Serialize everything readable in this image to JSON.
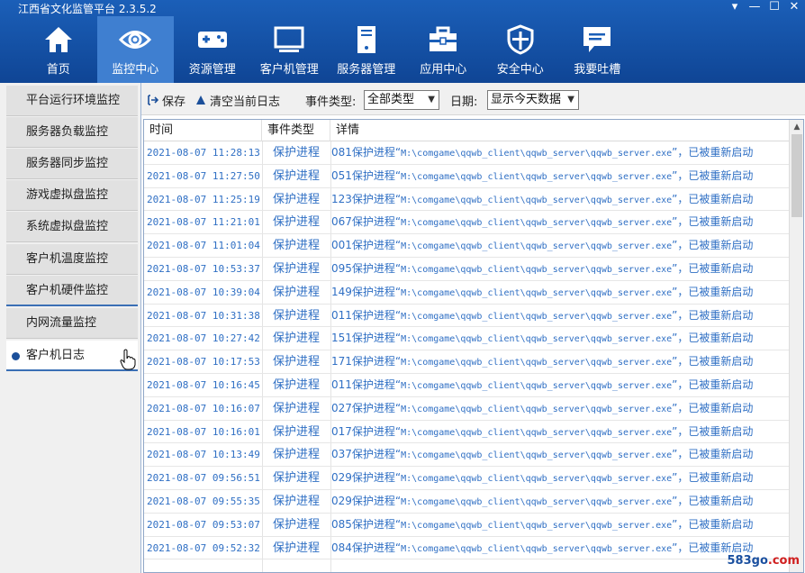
{
  "app": {
    "title": "江西省文化监管平台 2.3.5.2"
  },
  "window_controls": {
    "dropdown": "▾",
    "minimize": "—",
    "maximize": "☐",
    "close": "✕"
  },
  "nav": [
    {
      "label": "首页",
      "icon": "home-icon"
    },
    {
      "label": "监控中心",
      "icon": "eye-icon",
      "active": true
    },
    {
      "label": "资源管理",
      "icon": "gamepad-icon"
    },
    {
      "label": "客户机管理",
      "icon": "monitor-icon"
    },
    {
      "label": "服务器管理",
      "icon": "server-icon"
    },
    {
      "label": "应用中心",
      "icon": "toolbox-icon"
    },
    {
      "label": "安全中心",
      "icon": "shield-icon"
    },
    {
      "label": "我要吐槽",
      "icon": "chat-bubble-icon"
    }
  ],
  "sidebar": [
    {
      "label": "平台运行环境监控"
    },
    {
      "label": "服务器负载监控"
    },
    {
      "label": "服务器同步监控"
    },
    {
      "label": "游戏虚拟盘监控"
    },
    {
      "label": "系统虚拟盘监控"
    },
    {
      "label": "客户机温度监控"
    },
    {
      "label": "客户机硬件监控"
    },
    {
      "label": "内网流量监控"
    },
    {
      "label": "客户机日志",
      "active": true
    }
  ],
  "toolbar": {
    "save_label": "保存",
    "clear_label": "清空当前日志",
    "event_type_label": "事件类型:",
    "event_type_value": "全部类型",
    "date_label": "日期:",
    "date_value": "显示今天数据"
  },
  "table": {
    "columns": [
      "时间",
      "事件类型",
      "详情"
    ],
    "rows": [
      {
        "time": "2021-08-07 11:28:13",
        "type": "保护进程",
        "id": "081"
      },
      {
        "time": "2021-08-07 11:27:50",
        "type": "保护进程",
        "id": "051"
      },
      {
        "time": "2021-08-07 11:25:19",
        "type": "保护进程",
        "id": "123"
      },
      {
        "time": "2021-08-07 11:21:01",
        "type": "保护进程",
        "id": "067"
      },
      {
        "time": "2021-08-07 11:01:04",
        "type": "保护进程",
        "id": "001"
      },
      {
        "time": "2021-08-07 10:53:37",
        "type": "保护进程",
        "id": "095"
      },
      {
        "time": "2021-08-07 10:39:04",
        "type": "保护进程",
        "id": "149"
      },
      {
        "time": "2021-08-07 10:31:38",
        "type": "保护进程",
        "id": "011"
      },
      {
        "time": "2021-08-07 10:27:42",
        "type": "保护进程",
        "id": "151"
      },
      {
        "time": "2021-08-07 10:17:53",
        "type": "保护进程",
        "id": "171"
      },
      {
        "time": "2021-08-07 10:16:45",
        "type": "保护进程",
        "id": "011"
      },
      {
        "time": "2021-08-07 10:16:07",
        "type": "保护进程",
        "id": "027"
      },
      {
        "time": "2021-08-07 10:16:01",
        "type": "保护进程",
        "id": "017"
      },
      {
        "time": "2021-08-07 10:13:49",
        "type": "保护进程",
        "id": "037"
      },
      {
        "time": "2021-08-07 09:56:51",
        "type": "保护进程",
        "id": "029"
      },
      {
        "time": "2021-08-07 09:55:35",
        "type": "保护进程",
        "id": "029"
      },
      {
        "time": "2021-08-07 09:53:07",
        "type": "保护进程",
        "id": "085"
      },
      {
        "time": "2021-08-07 09:52:32",
        "type": "保护进程",
        "id": "084"
      }
    ],
    "detail_prefix": "保护进程“",
    "detail_path": "M:\\comgame\\qqwb_client\\qqwb_server\\qqwb_server.exe",
    "detail_suffix": "”，已被重新启动"
  },
  "watermark": {
    "part1": "583go",
    "part2": ".com"
  },
  "colors": {
    "header": "#1b5fb8",
    "nav_active": "#3f7fd0",
    "row_text": "#2f6fc4",
    "accent": "#3a6fb5"
  }
}
